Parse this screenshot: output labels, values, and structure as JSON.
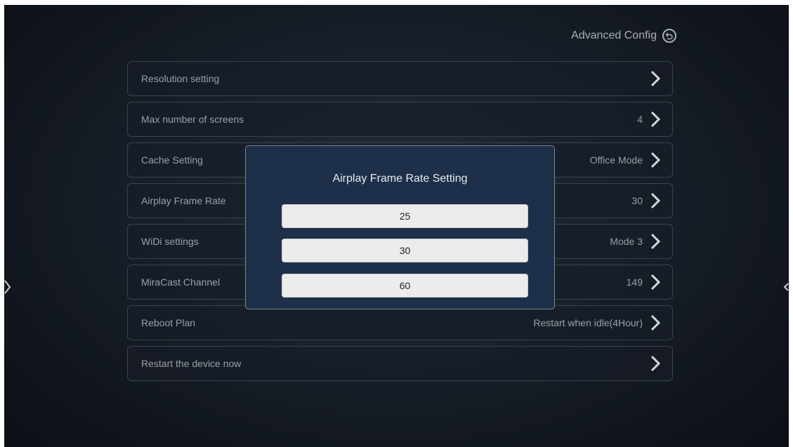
{
  "header": {
    "title": "Advanced Config",
    "back_icon": "back-icon"
  },
  "menu": [
    {
      "label": "Resolution setting",
      "value": ""
    },
    {
      "label": "Max number of screens",
      "value": "4"
    },
    {
      "label": "Cache Setting",
      "value": "Office Mode"
    },
    {
      "label": "Airplay Frame Rate ",
      "value": "30"
    },
    {
      "label": "WiDi settings",
      "value": "Mode 3"
    },
    {
      "label": "MiraCast Channel",
      "value": "149"
    },
    {
      "label": "Reboot Plan",
      "value": "Restart when idle(4Hour)"
    },
    {
      "label": "Restart the device now",
      "value": ""
    }
  ],
  "dialog": {
    "title": "Airplay Frame Rate Setting",
    "options": [
      "25",
      "30",
      "60"
    ]
  },
  "colors": {
    "dialog_bg": "#1d2f49",
    "option_bg": "#ececec",
    "text": "#9aa0a8"
  }
}
